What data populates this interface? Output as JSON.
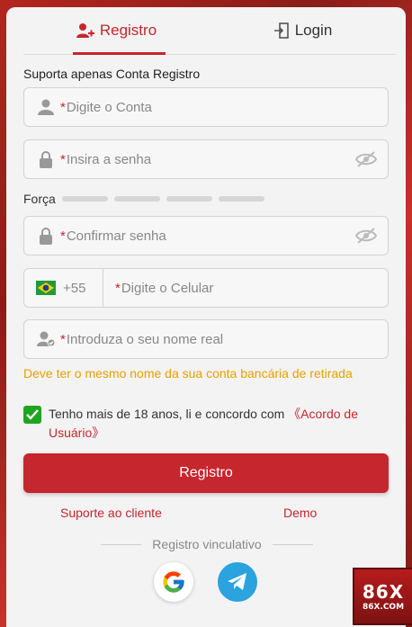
{
  "tabs": {
    "register": "Registro",
    "login": "Login"
  },
  "subtitle": "Suporta apenas Conta Registro",
  "fields": {
    "account": {
      "required": "*",
      "placeholder": "Digite o Conta"
    },
    "password": {
      "required": "*",
      "placeholder": "Insira a senha"
    },
    "confirm": {
      "required": "*",
      "placeholder": "Confirmar senha"
    },
    "phone": {
      "country_code": "+55",
      "required": "*",
      "placeholder": "Digite o Celular"
    },
    "realname": {
      "required": "*",
      "placeholder": "Introduza o seu nome real"
    }
  },
  "strength_label": "Força",
  "strength_level": 0,
  "name_note": "Deve ter o mesmo nome da sua conta bancária de retirada",
  "agreement": {
    "checked": true,
    "text": "Tenho mais de 18 anos, li e concordo com ",
    "link": "《Acordo de Usuário》"
  },
  "submit_label": "Registro",
  "links": {
    "support": "Suporte ao cliente",
    "demo": "Demo"
  },
  "divider_text": "Registro vinculativo",
  "social": [
    "google-icon",
    "telegram-icon"
  ],
  "brand": {
    "big": "86X",
    "small": "86X.COM"
  },
  "colors": {
    "accent": "#c6262e",
    "warning": "#e8a000",
    "check": "#1fa51f",
    "telegram": "#2aa3df"
  }
}
